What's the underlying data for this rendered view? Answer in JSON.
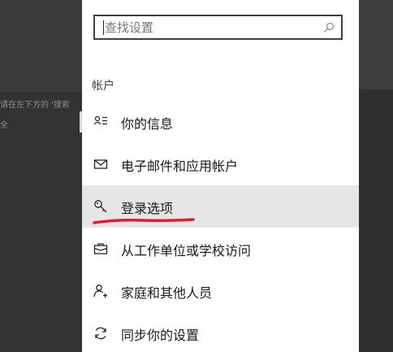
{
  "search": {
    "placeholder": "查找设置",
    "value": ""
  },
  "section_title": "帐户",
  "nav_items": [
    {
      "label": "你的信息",
      "icon": "person-card-icon",
      "selected": false
    },
    {
      "label": "电子邮件和应用帐户",
      "icon": "mail-icon",
      "selected": false
    },
    {
      "label": "登录选项",
      "icon": "key-icon",
      "selected": true
    },
    {
      "label": "从工作单位或学校访问",
      "icon": "briefcase-icon",
      "selected": false
    },
    {
      "label": "家庭和其他人员",
      "icon": "person-add-icon",
      "selected": false
    },
    {
      "label": "同步你的设置",
      "icon": "sync-icon",
      "selected": false
    }
  ],
  "background": {
    "left_text_line1": "请在左下方的 '搜索",
    "left_text_line2": "全"
  },
  "colors": {
    "selected_bg": "#e6e6e6",
    "annotation_red": "#e8192c",
    "panel_bg": "#ffffff"
  }
}
